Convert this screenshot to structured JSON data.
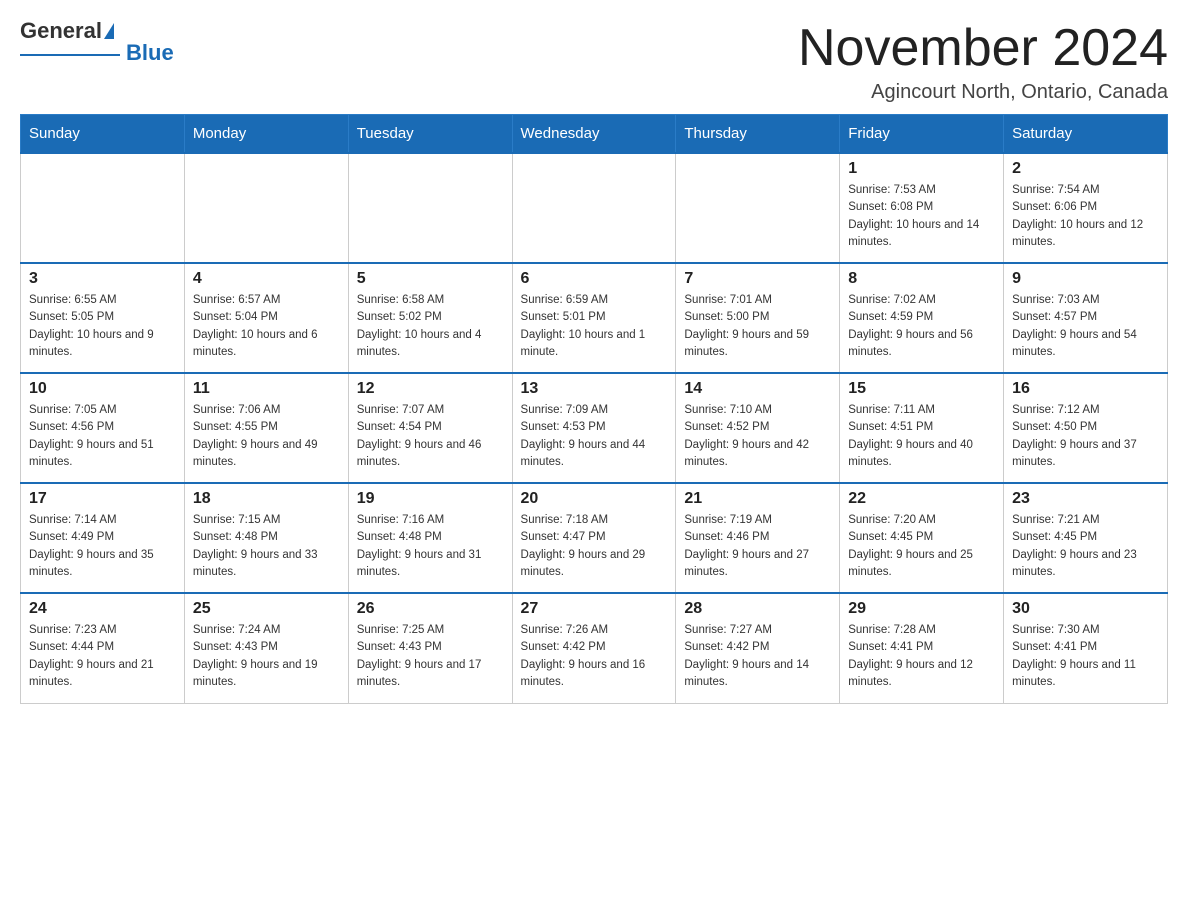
{
  "header": {
    "logo_general": "General",
    "logo_blue": "Blue",
    "month_title": "November 2024",
    "location": "Agincourt North, Ontario, Canada"
  },
  "weekdays": [
    "Sunday",
    "Monday",
    "Tuesday",
    "Wednesday",
    "Thursday",
    "Friday",
    "Saturday"
  ],
  "weeks": [
    [
      {
        "day": "",
        "sunrise": "",
        "sunset": "",
        "daylight": ""
      },
      {
        "day": "",
        "sunrise": "",
        "sunset": "",
        "daylight": ""
      },
      {
        "day": "",
        "sunrise": "",
        "sunset": "",
        "daylight": ""
      },
      {
        "day": "",
        "sunrise": "",
        "sunset": "",
        "daylight": ""
      },
      {
        "day": "",
        "sunrise": "",
        "sunset": "",
        "daylight": ""
      },
      {
        "day": "1",
        "sunrise": "Sunrise: 7:53 AM",
        "sunset": "Sunset: 6:08 PM",
        "daylight": "Daylight: 10 hours and 14 minutes."
      },
      {
        "day": "2",
        "sunrise": "Sunrise: 7:54 AM",
        "sunset": "Sunset: 6:06 PM",
        "daylight": "Daylight: 10 hours and 12 minutes."
      }
    ],
    [
      {
        "day": "3",
        "sunrise": "Sunrise: 6:55 AM",
        "sunset": "Sunset: 5:05 PM",
        "daylight": "Daylight: 10 hours and 9 minutes."
      },
      {
        "day": "4",
        "sunrise": "Sunrise: 6:57 AM",
        "sunset": "Sunset: 5:04 PM",
        "daylight": "Daylight: 10 hours and 6 minutes."
      },
      {
        "day": "5",
        "sunrise": "Sunrise: 6:58 AM",
        "sunset": "Sunset: 5:02 PM",
        "daylight": "Daylight: 10 hours and 4 minutes."
      },
      {
        "day": "6",
        "sunrise": "Sunrise: 6:59 AM",
        "sunset": "Sunset: 5:01 PM",
        "daylight": "Daylight: 10 hours and 1 minute."
      },
      {
        "day": "7",
        "sunrise": "Sunrise: 7:01 AM",
        "sunset": "Sunset: 5:00 PM",
        "daylight": "Daylight: 9 hours and 59 minutes."
      },
      {
        "day": "8",
        "sunrise": "Sunrise: 7:02 AM",
        "sunset": "Sunset: 4:59 PM",
        "daylight": "Daylight: 9 hours and 56 minutes."
      },
      {
        "day": "9",
        "sunrise": "Sunrise: 7:03 AM",
        "sunset": "Sunset: 4:57 PM",
        "daylight": "Daylight: 9 hours and 54 minutes."
      }
    ],
    [
      {
        "day": "10",
        "sunrise": "Sunrise: 7:05 AM",
        "sunset": "Sunset: 4:56 PM",
        "daylight": "Daylight: 9 hours and 51 minutes."
      },
      {
        "day": "11",
        "sunrise": "Sunrise: 7:06 AM",
        "sunset": "Sunset: 4:55 PM",
        "daylight": "Daylight: 9 hours and 49 minutes."
      },
      {
        "day": "12",
        "sunrise": "Sunrise: 7:07 AM",
        "sunset": "Sunset: 4:54 PM",
        "daylight": "Daylight: 9 hours and 46 minutes."
      },
      {
        "day": "13",
        "sunrise": "Sunrise: 7:09 AM",
        "sunset": "Sunset: 4:53 PM",
        "daylight": "Daylight: 9 hours and 44 minutes."
      },
      {
        "day": "14",
        "sunrise": "Sunrise: 7:10 AM",
        "sunset": "Sunset: 4:52 PM",
        "daylight": "Daylight: 9 hours and 42 minutes."
      },
      {
        "day": "15",
        "sunrise": "Sunrise: 7:11 AM",
        "sunset": "Sunset: 4:51 PM",
        "daylight": "Daylight: 9 hours and 40 minutes."
      },
      {
        "day": "16",
        "sunrise": "Sunrise: 7:12 AM",
        "sunset": "Sunset: 4:50 PM",
        "daylight": "Daylight: 9 hours and 37 minutes."
      }
    ],
    [
      {
        "day": "17",
        "sunrise": "Sunrise: 7:14 AM",
        "sunset": "Sunset: 4:49 PM",
        "daylight": "Daylight: 9 hours and 35 minutes."
      },
      {
        "day": "18",
        "sunrise": "Sunrise: 7:15 AM",
        "sunset": "Sunset: 4:48 PM",
        "daylight": "Daylight: 9 hours and 33 minutes."
      },
      {
        "day": "19",
        "sunrise": "Sunrise: 7:16 AM",
        "sunset": "Sunset: 4:48 PM",
        "daylight": "Daylight: 9 hours and 31 minutes."
      },
      {
        "day": "20",
        "sunrise": "Sunrise: 7:18 AM",
        "sunset": "Sunset: 4:47 PM",
        "daylight": "Daylight: 9 hours and 29 minutes."
      },
      {
        "day": "21",
        "sunrise": "Sunrise: 7:19 AM",
        "sunset": "Sunset: 4:46 PM",
        "daylight": "Daylight: 9 hours and 27 minutes."
      },
      {
        "day": "22",
        "sunrise": "Sunrise: 7:20 AM",
        "sunset": "Sunset: 4:45 PM",
        "daylight": "Daylight: 9 hours and 25 minutes."
      },
      {
        "day": "23",
        "sunrise": "Sunrise: 7:21 AM",
        "sunset": "Sunset: 4:45 PM",
        "daylight": "Daylight: 9 hours and 23 minutes."
      }
    ],
    [
      {
        "day": "24",
        "sunrise": "Sunrise: 7:23 AM",
        "sunset": "Sunset: 4:44 PM",
        "daylight": "Daylight: 9 hours and 21 minutes."
      },
      {
        "day": "25",
        "sunrise": "Sunrise: 7:24 AM",
        "sunset": "Sunset: 4:43 PM",
        "daylight": "Daylight: 9 hours and 19 minutes."
      },
      {
        "day": "26",
        "sunrise": "Sunrise: 7:25 AM",
        "sunset": "Sunset: 4:43 PM",
        "daylight": "Daylight: 9 hours and 17 minutes."
      },
      {
        "day": "27",
        "sunrise": "Sunrise: 7:26 AM",
        "sunset": "Sunset: 4:42 PM",
        "daylight": "Daylight: 9 hours and 16 minutes."
      },
      {
        "day": "28",
        "sunrise": "Sunrise: 7:27 AM",
        "sunset": "Sunset: 4:42 PM",
        "daylight": "Daylight: 9 hours and 14 minutes."
      },
      {
        "day": "29",
        "sunrise": "Sunrise: 7:28 AM",
        "sunset": "Sunset: 4:41 PM",
        "daylight": "Daylight: 9 hours and 12 minutes."
      },
      {
        "day": "30",
        "sunrise": "Sunrise: 7:30 AM",
        "sunset": "Sunset: 4:41 PM",
        "daylight": "Daylight: 9 hours and 11 minutes."
      }
    ]
  ]
}
